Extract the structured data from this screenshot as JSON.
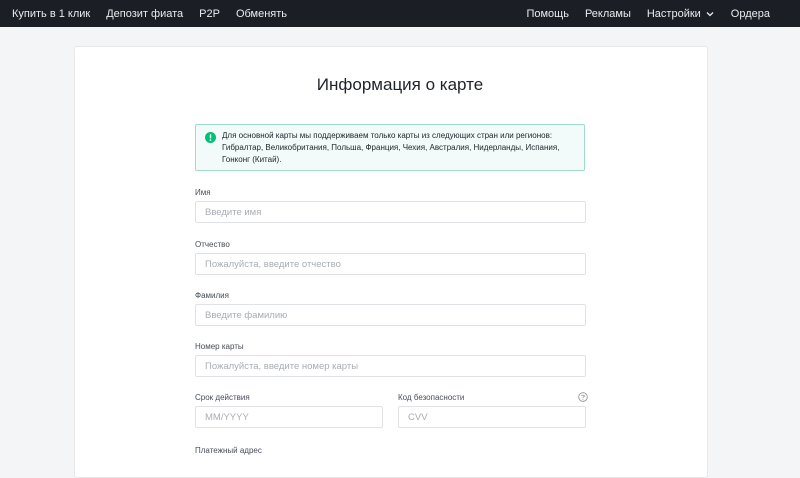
{
  "nav": {
    "left": [
      "Купить в 1 клик",
      "Депозит фиата",
      "P2P",
      "Обменять"
    ],
    "right": {
      "help": "Помощь",
      "ads": "Рекламы",
      "settings": "Настройки",
      "orders": "Ордера"
    }
  },
  "page": {
    "title": "Информация о карте"
  },
  "notice": {
    "text": "Для основной карты мы поддерживаем только карты из следующих стран или регионов: Гибралтар, Великобритания, Польша, Франция, Чехия, Австралия, Нидерланды, Испания, Гонконг (Китай).",
    "color": "#02c076"
  },
  "form": {
    "first_name": {
      "label": "Имя",
      "placeholder": "Введите имя"
    },
    "middle_name": {
      "label": "Отчество",
      "placeholder": "Пожалуйста, введите отчество"
    },
    "last_name": {
      "label": "Фамилия",
      "placeholder": "Введите фамилию"
    },
    "card_number": {
      "label": "Номер карты",
      "placeholder": "Пожалуйста, введите номер карты"
    },
    "expiry": {
      "label": "Срок действия",
      "placeholder": "MM/YYYY"
    },
    "cvv": {
      "label": "Код безопасности",
      "placeholder": "CVV"
    },
    "billing_address": {
      "label": "Платежный адрес"
    }
  }
}
